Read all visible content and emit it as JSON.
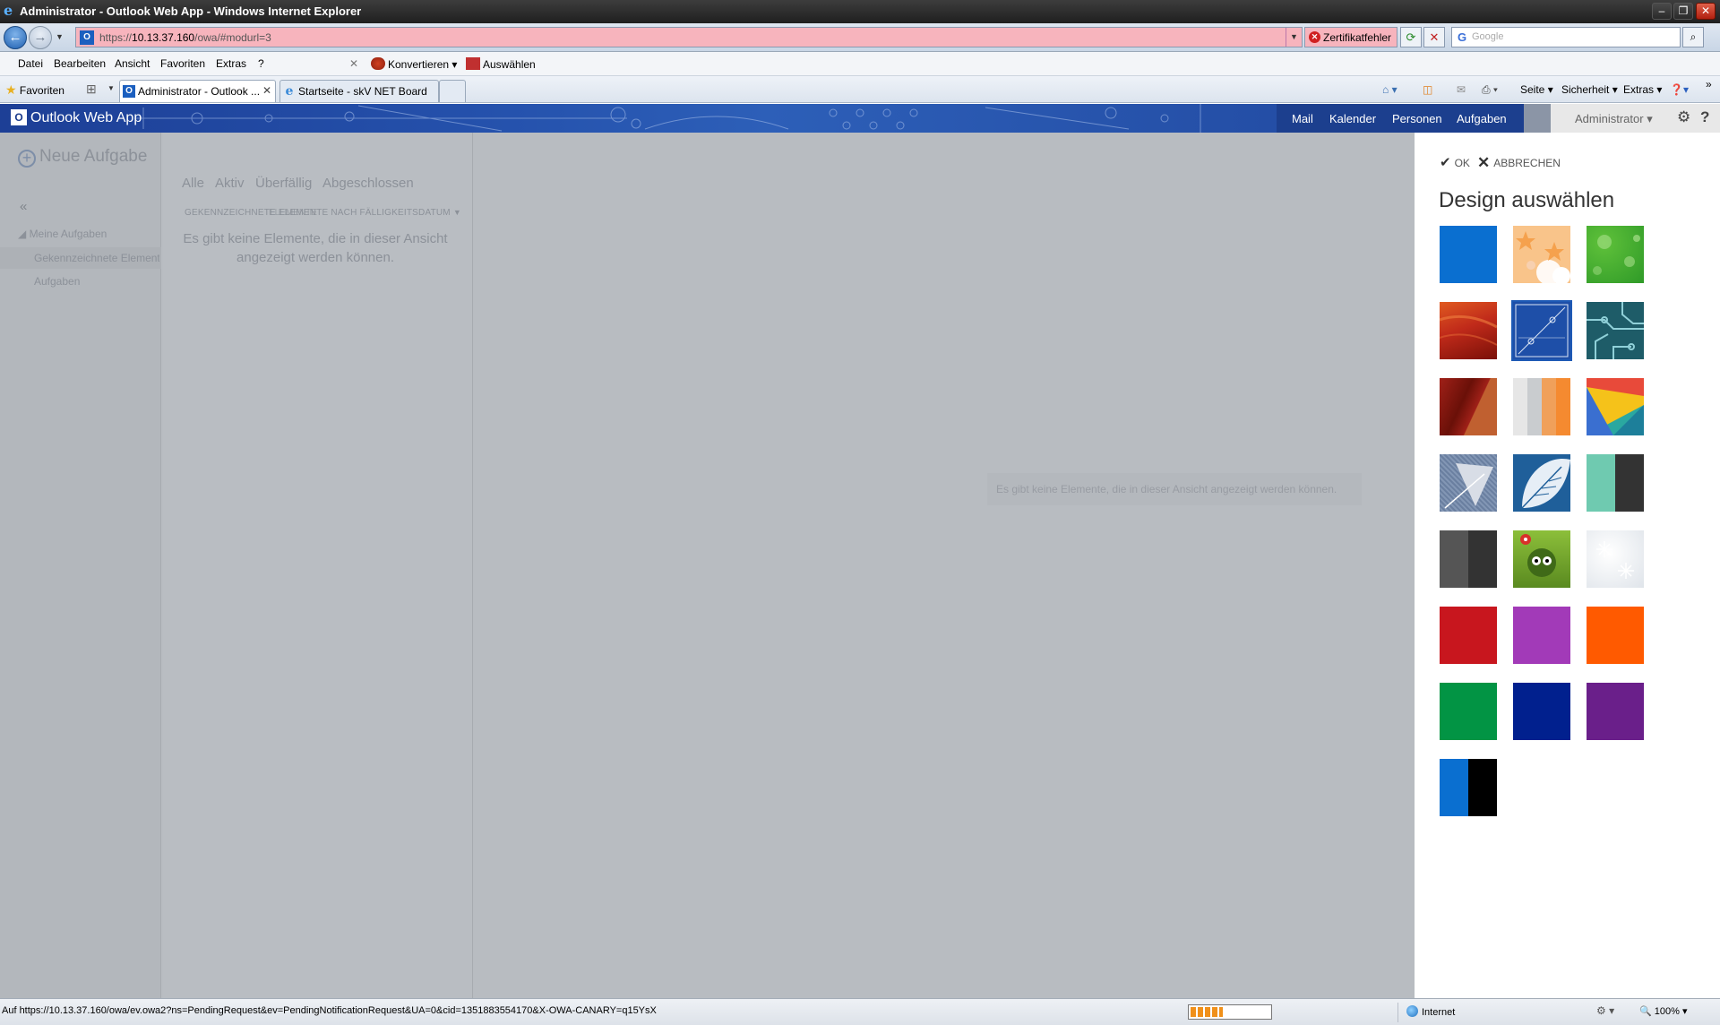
{
  "window": {
    "title": "Administrator - Outlook Web App - Windows Internet Explorer",
    "minimize": "–",
    "restore": "❐",
    "close": "✕"
  },
  "addressbar": {
    "url_prefix": "https://",
    "url_host": "10.13.37.160",
    "url_path": "/owa/#modurl=3",
    "cert_error": "Zertifikatfehler",
    "search_placeholder": "Google",
    "background_color": "#f7b4bd"
  },
  "menu": {
    "items": [
      "Datei",
      "Bearbeiten",
      "Ansicht",
      "Favoriten",
      "Extras",
      "?"
    ],
    "convert": "Konvertieren",
    "select": "Auswählen"
  },
  "tabbar": {
    "favorites": "Favoriten",
    "tabs": [
      {
        "label": "Administrator - Outlook ...",
        "active": true
      },
      {
        "label": "Startseite - skV NET Board",
        "active": false
      }
    ],
    "commands": [
      "Seite",
      "Sicherheit",
      "Extras"
    ]
  },
  "owa": {
    "app_title": "Outlook Web App",
    "nav": [
      "Mail",
      "Kalender",
      "Personen",
      "Aufgaben"
    ],
    "active_nav": "Aufgaben",
    "user": "Administrator",
    "new_task": "Neue Aufgabe",
    "filters": [
      "Alle",
      "Aktiv",
      "Überfällig",
      "Abgeschlossen"
    ],
    "collapse": "«",
    "folders": {
      "root": "Meine Aufgaben",
      "flagged": "Gekennzeichnete Elemente",
      "tasks": "Aufgaben"
    },
    "sort_header": "GEKENNZEICHNETE ELEMENTE NACH FÄLLIGKEITSDATUM",
    "sort_header_overlap": "ELEMENTE",
    "empty_list": "Es gibt keine Elemente, die in dieser Ansicht angezeigt werden können.",
    "empty_reading": "Es gibt keine Elemente, die in dieser Ansicht angezeigt werden können.",
    "header_color": "#1a3a8c"
  },
  "theme_panel": {
    "ok": "OK",
    "cancel": "ABBRECHEN",
    "title": "Design auswählen",
    "selected_index": 4,
    "themes": [
      {
        "name": "blue",
        "kind": "solid",
        "colors": [
          "#0a6fd0"
        ]
      },
      {
        "name": "stars",
        "kind": "stars",
        "colors": [
          "#f9c48a",
          "#f5a14d",
          "#fff"
        ]
      },
      {
        "name": "green-bokeh",
        "kind": "bokeh",
        "colors": [
          "#5fc13a",
          "#2f9a28",
          "#b8e89a"
        ]
      },
      {
        "name": "red-paint",
        "kind": "paint",
        "colors": [
          "#c02a1a",
          "#e05a20",
          "#7a1008"
        ]
      },
      {
        "name": "blueprint",
        "kind": "blueprint",
        "colors": [
          "#1e4fa8",
          "#dce6f5"
        ]
      },
      {
        "name": "circuit",
        "kind": "circuit",
        "colors": [
          "#1e5c68",
          "#8fd0d8"
        ]
      },
      {
        "name": "wood",
        "kind": "wood",
        "colors": [
          "#a02018",
          "#c06030",
          "#6a1008"
        ]
      },
      {
        "name": "stripes",
        "kind": "stripes",
        "colors": [
          "#e6e6e6",
          "#c9cccf",
          "#f0a05a",
          "#f58a30"
        ]
      },
      {
        "name": "geometric",
        "kind": "geometric",
        "colors": [
          "#f5c21a",
          "#e84a3a",
          "#2aa8a0",
          "#3a6fd0"
        ]
      },
      {
        "name": "denim-leaf",
        "kind": "denim",
        "colors": [
          "#6a7fa0",
          "#d8dde6"
        ]
      },
      {
        "name": "leaf",
        "kind": "leaf",
        "colors": [
          "#1f5f9a",
          "#e6eef6"
        ]
      },
      {
        "name": "teal-dark",
        "kind": "split",
        "colors": [
          "#6fcab0",
          "#333"
        ]
      },
      {
        "name": "gray-dark",
        "kind": "split",
        "colors": [
          "#555",
          "#333"
        ]
      },
      {
        "name": "cat",
        "kind": "cat",
        "colors": [
          "#8cbf3a",
          "#5a8a20"
        ]
      },
      {
        "name": "snow",
        "kind": "snow",
        "colors": [
          "#dfe4ea",
          "#fff"
        ]
      },
      {
        "name": "red",
        "kind": "solid",
        "colors": [
          "#c8161e"
        ]
      },
      {
        "name": "purple",
        "kind": "solid",
        "colors": [
          "#a23ab8"
        ]
      },
      {
        "name": "orange",
        "kind": "solid",
        "colors": [
          "#ff5a00"
        ]
      },
      {
        "name": "green",
        "kind": "solid",
        "colors": [
          "#029444"
        ]
      },
      {
        "name": "navy",
        "kind": "solid",
        "colors": [
          "#01208e"
        ]
      },
      {
        "name": "violet",
        "kind": "solid",
        "colors": [
          "#6a1f8a"
        ]
      },
      {
        "name": "blue-black",
        "kind": "split",
        "colors": [
          "#0a6fd0",
          "#000"
        ]
      }
    ]
  },
  "statusbar": {
    "message": "Auf https://10.13.37.160/owa/ev.owa2?ns=PendingRequest&ev=PendingNotificationRequest&UA=0&cid=1351883554170&X-OWA-CANARY=q15YsX",
    "progress": 0.4,
    "zone": "Internet",
    "zoom": "100%"
  }
}
